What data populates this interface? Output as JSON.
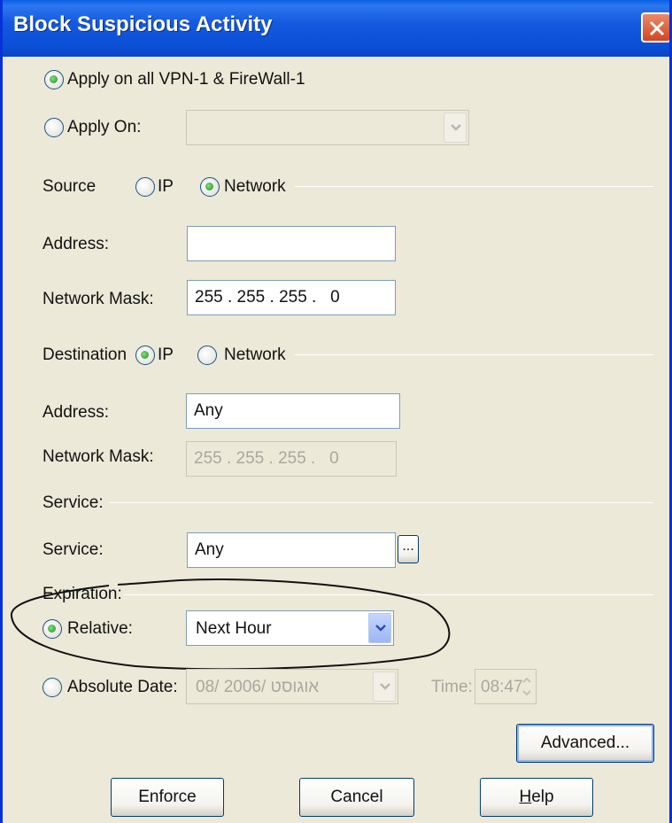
{
  "window": {
    "title": "Block Suspicious Activity"
  },
  "apply": {
    "all_label": "Apply on all VPN-1 & FireWall-1",
    "on_label": "Apply On:",
    "selected": "all",
    "on_value": ""
  },
  "source": {
    "label": "Source",
    "ip_label": "IP",
    "network_label": "Network",
    "selected": "Network",
    "address_label": "Address:",
    "address_value": "",
    "mask_label": "Network Mask:",
    "mask_value": "255 . 255 . 255 .   0"
  },
  "destination": {
    "label": "Destination",
    "ip_label": "IP",
    "network_label": "Network",
    "selected": "IP",
    "address_label": "Address:",
    "address_value": "Any",
    "mask_label": "Network Mask:",
    "mask_value": "255 . 255 . 255 .   0"
  },
  "service": {
    "group_label": "Service:",
    "label": "Service:",
    "value": "Any",
    "browse_label": "..."
  },
  "expiration": {
    "group_label": "Expiration:",
    "relative_label": "Relative:",
    "relative_value": "Next Hour",
    "selected": "Relative",
    "absolute_label": "Absolute  Date:",
    "absolute_date_value": "08/ אוגוסט /2006",
    "time_label": "Time:",
    "time_value": "08:47"
  },
  "buttons": {
    "advanced": "Advanced...",
    "enforce": "Enforce",
    "cancel": "Cancel",
    "help_underlined": "H",
    "help_rest": "elp"
  },
  "colors": {
    "title_bar": "#0b4fd6",
    "dialog_bg": "#ece9d8",
    "radio_dot": "#1e8e1e"
  }
}
